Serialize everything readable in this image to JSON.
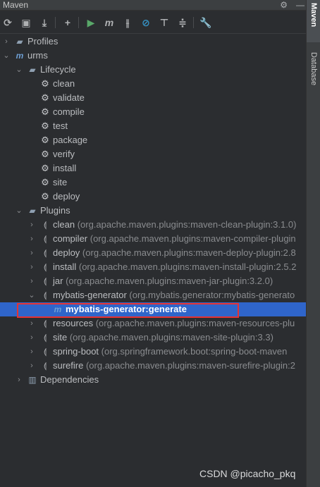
{
  "title": "Maven",
  "title_actions": [
    "gear-icon",
    "minimize-icon"
  ],
  "toolbar": [
    "reload-icon",
    "add-folder-icon",
    "download-icon",
    "plus-icon",
    "run-icon",
    "maven-goal-icon",
    "toggle-offline-icon",
    "skip-tests-icon",
    "show-dependencies-icon",
    "expand-all-icon",
    "wrench-icon"
  ],
  "tree": [
    {
      "label": "Profiles",
      "detail": "",
      "level": 0,
      "arrow": "›",
      "icon": "folder"
    },
    {
      "label": "urms",
      "detail": "",
      "level": 0,
      "arrow": "⌄",
      "icon": "m"
    },
    {
      "label": "Lifecycle",
      "detail": "",
      "level": 1,
      "arrow": "⌄",
      "icon": "folder"
    },
    {
      "label": "clean",
      "detail": "",
      "level": 2,
      "arrow": "",
      "icon": "gear"
    },
    {
      "label": "validate",
      "detail": "",
      "level": 2,
      "arrow": "",
      "icon": "gear"
    },
    {
      "label": "compile",
      "detail": "",
      "level": 2,
      "arrow": "",
      "icon": "gear"
    },
    {
      "label": "test",
      "detail": "",
      "level": 2,
      "arrow": "",
      "icon": "gear"
    },
    {
      "label": "package",
      "detail": "",
      "level": 2,
      "arrow": "",
      "icon": "gear"
    },
    {
      "label": "verify",
      "detail": "",
      "level": 2,
      "arrow": "",
      "icon": "gear"
    },
    {
      "label": "install",
      "detail": "",
      "level": 2,
      "arrow": "",
      "icon": "gear"
    },
    {
      "label": "site",
      "detail": "",
      "level": 2,
      "arrow": "",
      "icon": "gear"
    },
    {
      "label": "deploy",
      "detail": "",
      "level": 2,
      "arrow": "",
      "icon": "gear"
    },
    {
      "label": "Plugins",
      "detail": "",
      "level": 1,
      "arrow": "⌄",
      "icon": "folder"
    },
    {
      "label": "clean",
      "detail": "(org.apache.maven.plugins:maven-clean-plugin:3.1.0)",
      "level": 2,
      "arrow": "›",
      "icon": "plugin"
    },
    {
      "label": "compiler",
      "detail": "(org.apache.maven.plugins:maven-compiler-plugin",
      "level": 2,
      "arrow": "›",
      "icon": "plugin"
    },
    {
      "label": "deploy",
      "detail": "(org.apache.maven.plugins:maven-deploy-plugin:2.8",
      "level": 2,
      "arrow": "›",
      "icon": "plugin"
    },
    {
      "label": "install",
      "detail": "(org.apache.maven.plugins:maven-install-plugin:2.5.2",
      "level": 2,
      "arrow": "›",
      "icon": "plugin"
    },
    {
      "label": "jar",
      "detail": "(org.apache.maven.plugins:maven-jar-plugin:3.2.0)",
      "level": 2,
      "arrow": "›",
      "icon": "plugin"
    },
    {
      "label": "mybatis-generator",
      "detail": "(org.mybatis.generator:mybatis-generato",
      "level": 2,
      "arrow": "⌄",
      "icon": "plugin"
    },
    {
      "label": "mybatis-generator:generate",
      "detail": "",
      "level": 3,
      "arrow": "",
      "icon": "m",
      "selected": true
    },
    {
      "label": "resources",
      "detail": "(org.apache.maven.plugins:maven-resources-plu",
      "level": 2,
      "arrow": "›",
      "icon": "plugin"
    },
    {
      "label": "site",
      "detail": "(org.apache.maven.plugins:maven-site-plugin:3.3)",
      "level": 2,
      "arrow": "›",
      "icon": "plugin"
    },
    {
      "label": "spring-boot",
      "detail": "(org.springframework.boot:spring-boot-maven",
      "level": 2,
      "arrow": "›",
      "icon": "plugin"
    },
    {
      "label": "surefire",
      "detail": "(org.apache.maven.plugins:maven-surefire-plugin:2",
      "level": 2,
      "arrow": "›",
      "icon": "plugin"
    },
    {
      "label": "Dependencies",
      "detail": "",
      "level": 1,
      "arrow": "›",
      "icon": "deps"
    }
  ],
  "side_tabs": [
    {
      "label": "Maven",
      "active": true
    },
    {
      "label": "Database",
      "active": false
    }
  ],
  "watermark": "CSDN @picacho_pkq",
  "colors": {
    "background": "#2b2d30",
    "selection": "#2f65ca",
    "highlight_box": "#e53232"
  }
}
